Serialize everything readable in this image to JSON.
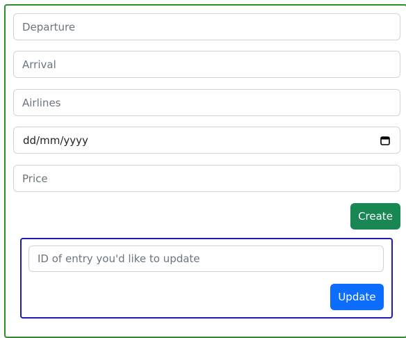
{
  "create_form": {
    "departure": {
      "placeholder": "Departure",
      "value": ""
    },
    "arrival": {
      "placeholder": "Arrival",
      "value": ""
    },
    "airlines": {
      "placeholder": "Airlines",
      "value": ""
    },
    "date": {
      "display": "dd/mm/yyyy",
      "icon": "calendar-icon"
    },
    "price": {
      "placeholder": "Price",
      "value": ""
    },
    "create_label": "Create"
  },
  "update_form": {
    "id": {
      "placeholder": "ID of entry you'd like to update",
      "value": ""
    },
    "update_label": "Update"
  },
  "colors": {
    "create_panel_border": "#2e8b2e",
    "update_panel_border": "#1a1ab5",
    "create_button": "#198754",
    "update_button": "#0d6efd"
  }
}
